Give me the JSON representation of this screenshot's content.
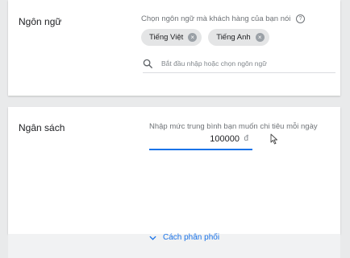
{
  "language_section": {
    "label": "Ngôn ngữ",
    "hint": "Chọn ngôn ngữ mà khách hàng của bạn nói",
    "help_icon": "?",
    "chips": [
      "Tiếng Việt",
      "Tiếng Anh"
    ],
    "search_placeholder": "Bắt đầu nhập hoặc chọn ngôn ngữ"
  },
  "budget_section": {
    "label": "Ngân sách",
    "hint": "Nhập mức trung bình bạn muốn chi tiêu mỗi ngày",
    "value": "100000",
    "currency": "đ"
  },
  "distribution_toggle": {
    "label": "Cách phân phối"
  },
  "colors": {
    "accent": "#1a73e8",
    "chip_bg": "#e4e5e6",
    "page_bg": "#e9eaeb"
  }
}
